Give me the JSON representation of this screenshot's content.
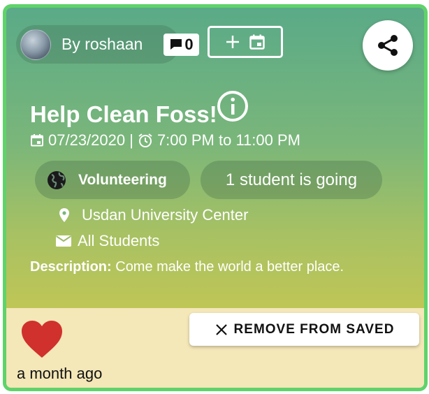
{
  "author": {
    "label": "By roshaan"
  },
  "comments": {
    "count": "0"
  },
  "event": {
    "title": "Help Clean Foss!",
    "date_time": "07/23/2020 | ",
    "time_range": "7:00 PM to 11:00 PM",
    "category": "Volunteering",
    "going": "1 student is going",
    "location": "Usdan University Center",
    "audience": "All Students",
    "description_label": "Description:",
    "description": " Come make the world a better place."
  },
  "footer": {
    "posted": "a month ago",
    "remove_label": "REMOVE FROM SAVED"
  },
  "colors": {
    "border": "#5fd36a",
    "heart": "#d0312d",
    "footer_bg": "#f4e7b8"
  },
  "icons": [
    "avatar",
    "comment-icon",
    "add-calendar-icon",
    "share-icon",
    "info-icon",
    "calendar-icon",
    "alarm-icon",
    "globe-icon",
    "location-pin-icon",
    "mail-icon",
    "heart-icon",
    "close-icon"
  ]
}
